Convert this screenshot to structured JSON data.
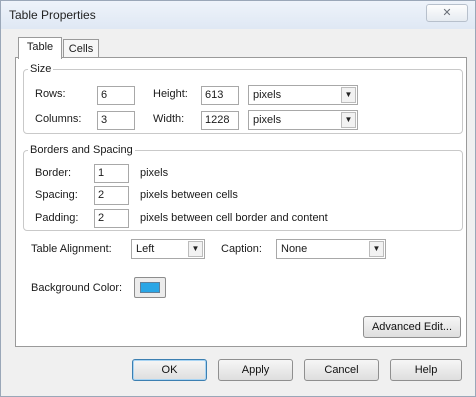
{
  "window": {
    "title": "Table Properties",
    "close_glyph": "✕"
  },
  "tabs": [
    {
      "label": "Table",
      "active": true
    },
    {
      "label": "Cells",
      "active": false
    }
  ],
  "size": {
    "legend": "Size",
    "rows_label": "Rows:",
    "rows_value": "6",
    "columns_label": "Columns:",
    "columns_value": "3",
    "height_label": "Height:",
    "height_value": "613",
    "height_unit": "pixels",
    "width_label": "Width:",
    "width_value": "1228",
    "width_unit": "pixels"
  },
  "borders": {
    "legend": "Borders and Spacing",
    "border_label": "Border:",
    "border_value": "1",
    "border_suffix": "pixels",
    "spacing_label": "Spacing:",
    "spacing_value": "2",
    "spacing_suffix": "pixels between cells",
    "padding_label": "Padding:",
    "padding_value": "2",
    "padding_suffix": "pixels between cell border and content"
  },
  "alignment": {
    "label": "Table Alignment:",
    "value": "Left",
    "caption_label": "Caption:",
    "caption_value": "None"
  },
  "background": {
    "label": "Background Color:",
    "color": "#29a6e6"
  },
  "advanced_edit_label": "Advanced Edit...",
  "buttons": {
    "ok": "OK",
    "apply": "Apply",
    "cancel": "Cancel",
    "help": "Help"
  },
  "icons": {
    "dropdown": "dropdown-arrow-icon",
    "close": "close-icon"
  }
}
